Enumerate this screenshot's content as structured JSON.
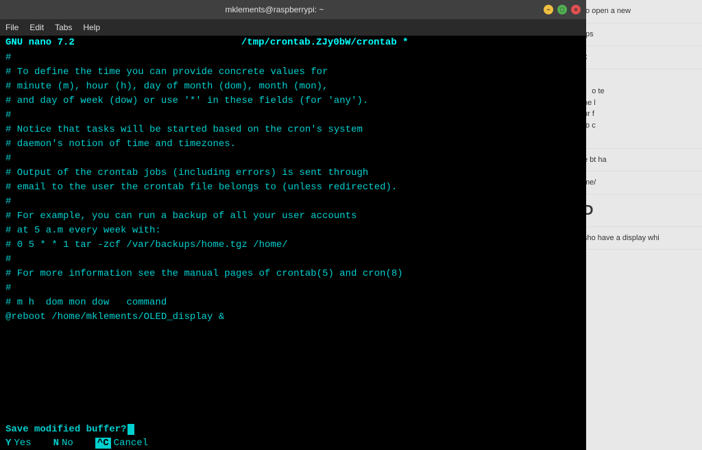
{
  "titleBar": {
    "title": "mklements@raspberrypi: ~",
    "minimizeLabel": "−",
    "maximizeLabel": "□",
    "closeLabel": "×"
  },
  "menuBar": {
    "items": [
      "File",
      "Edit",
      "Tabs",
      "Help"
    ]
  },
  "nanoHeader": {
    "left": "GNU nano 7.2",
    "center": "/tmp/crontab.ZJy0bW/crontab *"
  },
  "editorLines": [
    "#",
    "# To define the time you can provide concrete values for",
    "# minute (m), hour (h), day of month (dom), month (mon),",
    "# and day of week (dow) or use '*' in these fields (for 'any').",
    "#",
    "# Notice that tasks will be started based on the cron's system",
    "# daemon's notion of time and timezones.",
    "#",
    "# Output of the crontab jobs (including errors) is sent through",
    "# email to the user the crontab file belongs to (unless redirected).",
    "#",
    "# For example, you can run a backup of all your user accounts",
    "# at 5 a.m every week with:",
    "# 0 5 * * 1 tar -zcf /var/backups/home.tgz /home/",
    "#",
    "# For more information see the manual pages of crontab(5) and cron(8)",
    "#",
    "# m h  dom mon dow   command",
    "@reboot /home/mklements/OLED_display &"
  ],
  "savePrompt": {
    "text": "Save modified buffer?",
    "options": [
      {
        "key": "Y",
        "label": "Yes"
      },
      {
        "key": "N",
        "label": "No"
      },
      {
        "keyBox": "^C",
        "label": "Cancel"
      }
    ]
  },
  "rightPanel": {
    "sections": [
      {
        "text": "to open a new"
      },
      {
        "text": "tps"
      },
      {
        "text": "x"
      },
      {
        "text": "o te\nne l\nur f\nto c"
      },
      {
        "text": "e bt\nha"
      },
      {
        "text": "me/"
      },
      {
        "text": "D"
      },
      {
        "text": "sho\nhave a display whi"
      }
    ]
  }
}
